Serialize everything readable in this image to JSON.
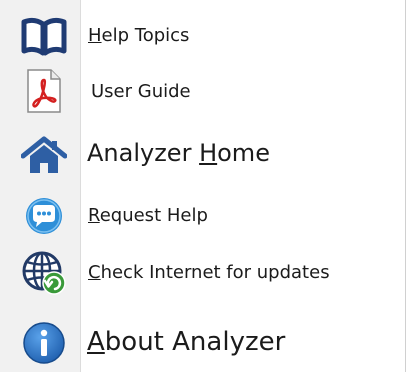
{
  "menu": {
    "items": [
      {
        "icon": "open-book-icon",
        "label_mnemonic": "H",
        "label_rest": "elp Topics",
        "icon_color": "#1f3b73"
      },
      {
        "icon": "pdf-document-icon",
        "label_mnemonic": "",
        "label_rest": "User Guide",
        "icon_color": "#d42020"
      },
      {
        "icon": "home-icon",
        "label_before": "Analyzer ",
        "label_mnemonic": "H",
        "label_rest": "ome",
        "icon_color": "#2e5fa4"
      },
      {
        "icon": "chat-bubble-icon",
        "label_mnemonic": "R",
        "label_rest": "equest Help",
        "icon_color": "#2e8fd8"
      },
      {
        "icon": "globe-refresh-icon",
        "label_mnemonic": "C",
        "label_rest": "heck Internet for updates",
        "icon_color": "#223a66"
      },
      {
        "icon": "info-icon",
        "label_mnemonic": "A",
        "label_rest": "bout Analyzer",
        "icon_color": "#2b6fc2"
      }
    ]
  }
}
